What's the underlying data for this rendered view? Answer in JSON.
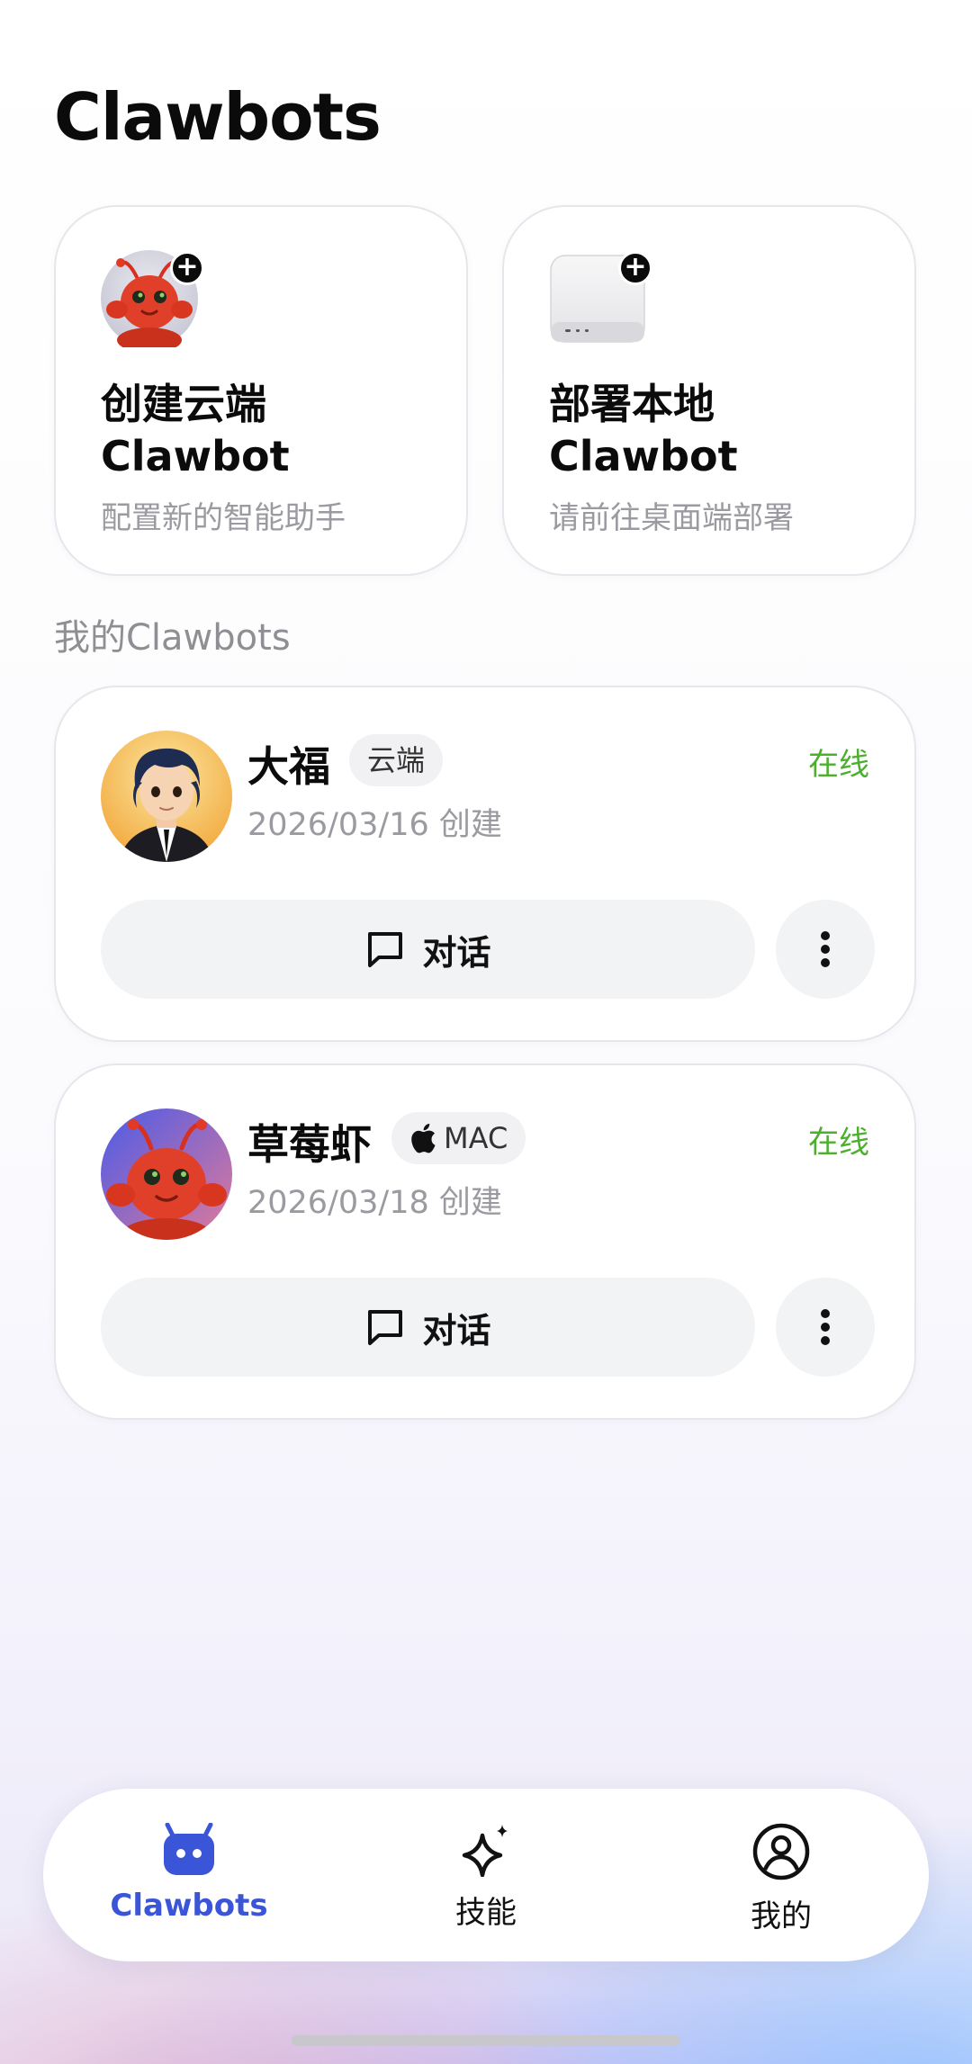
{
  "header": {
    "title": "Clawbots"
  },
  "create_cards": [
    {
      "title": "创建云端 Clawbot",
      "subtitle": "配置新的智能助手",
      "icon": "lobster-avatar-icon"
    },
    {
      "title": "部署本地 Clawbot",
      "subtitle": "请前往桌面端部署",
      "icon": "mac-mini-icon"
    }
  ],
  "section": {
    "label": "我的Clawbots"
  },
  "bots": [
    {
      "name": "大福",
      "tag": "云端",
      "date": "2026/03/16 创建",
      "status": "在线",
      "chat_label": "对话"
    },
    {
      "name": "草莓虾",
      "tag": "MAC",
      "date": "2026/03/18 创建",
      "status": "在线",
      "chat_label": "对话"
    }
  ],
  "tabs": [
    {
      "label": "Clawbots",
      "active": true
    },
    {
      "label": "技能",
      "active": false
    },
    {
      "label": "我的",
      "active": false
    }
  ],
  "colors": {
    "accent": "#3b55d8",
    "online": "#4caf2e"
  }
}
